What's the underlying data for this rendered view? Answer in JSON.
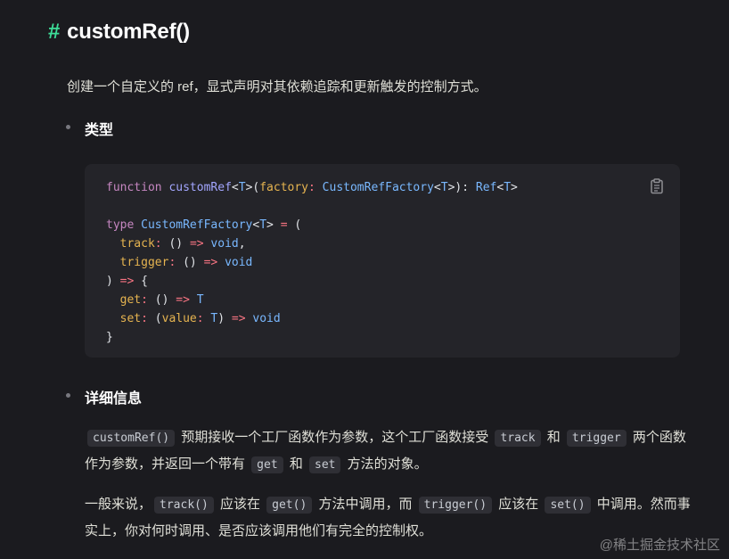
{
  "heading": {
    "anchor": "#",
    "title": "customRef()"
  },
  "intro": "创建一个自定义的 ref，显式声明对其依赖追踪和更新触发的控制方式。",
  "sections": {
    "type_label": "类型",
    "details_label": "详细信息"
  },
  "code": {
    "copy_icon": "clipboard-icon",
    "lines": [
      "function customRef<T>(factory: CustomRefFactory<T>): Ref<T>",
      "",
      "type CustomRefFactory<T> = (",
      "  track: () => void,",
      "  trigger: () => void",
      ") => {",
      "  get: () => T",
      "  set: (value: T) => void",
      "}"
    ]
  },
  "para1": {
    "c1": "customRef()",
    "t1": " 预期接收一个工厂函数作为参数，这个工厂函数接受 ",
    "c2": "track",
    "t2": " 和 ",
    "c3": "trigger",
    "t3": " 两个函数作为参数，并返回一个带有 ",
    "c4": "get",
    "t4": " 和 ",
    "c5": "set",
    "t5": " 方法的对象。"
  },
  "para2": {
    "t0": "一般来说，",
    "c1": "track()",
    "t1": " 应该在 ",
    "c2": "get()",
    "t2": " 方法中调用，而 ",
    "c3": "trigger()",
    "t3": " 应该在 ",
    "c4": "set()",
    "t4": " 中调用。然而事实上，你对何时调用、是否应该调用他们有完全的控制权。"
  },
  "watermark": "@稀土掘金技术社区"
}
